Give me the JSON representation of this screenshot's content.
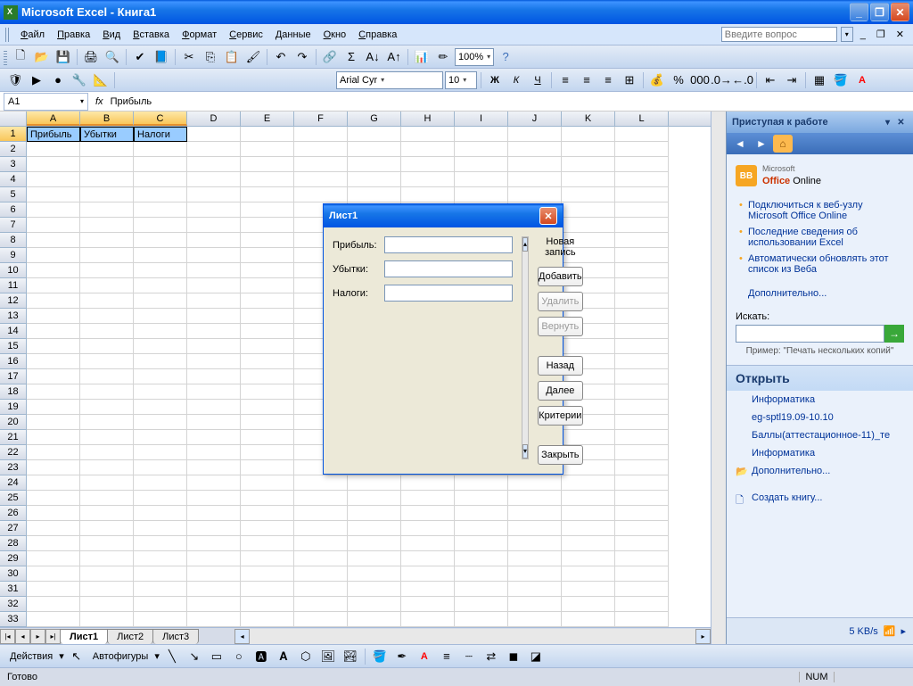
{
  "title": "Microsoft Excel - Книга1",
  "menu": [
    "Файл",
    "Правка",
    "Вид",
    "Вставка",
    "Формат",
    "Сервис",
    "Данные",
    "Окно",
    "Справка"
  ],
  "help_placeholder": "Введите вопрос",
  "zoom": "100%",
  "font": {
    "name": "Arial Cyr",
    "size": "10"
  },
  "namebox": "A1",
  "formula": "Прибыль",
  "columns": [
    "A",
    "B",
    "C",
    "D",
    "E",
    "F",
    "G",
    "H",
    "I",
    "J",
    "K",
    "L"
  ],
  "selected_cols": [
    "A",
    "B",
    "C"
  ],
  "headers": [
    "Прибыль",
    "Убытки",
    "Налоги"
  ],
  "row_count": 33,
  "sheet_tabs": [
    "Лист1",
    "Лист2",
    "Лист3"
  ],
  "active_tab": "Лист1",
  "dialog": {
    "title": "Лист1",
    "fields": [
      {
        "label": "Прибыль:"
      },
      {
        "label": "Убытки:"
      },
      {
        "label": "Налоги:"
      }
    ],
    "status": "Новая запись",
    "buttons": {
      "add": "Добавить",
      "delete": "Удалить",
      "revert": "Вернуть",
      "prev": "Назад",
      "next": "Далее",
      "criteria": "Критерии",
      "close": "Закрыть"
    }
  },
  "taskpane": {
    "title": "Приступая к работе",
    "brand_ms": "Microsoft",
    "brand": "Office Online",
    "links": [
      "Подключиться к веб-узлу Microsoft Office Online",
      "Последние сведения об использовании Excel",
      "Автоматически обновлять этот список из Веба"
    ],
    "more": "Дополнительно...",
    "search_label": "Искать:",
    "example": "Пример: \"Печать нескольких копий\"",
    "open_header": "Открыть",
    "recent": [
      "Информатика",
      "eg-sptl19.09-10.10",
      "Баллы(аттестационное-11)_те",
      "Информатика"
    ],
    "more_open": "Дополнительно...",
    "create": "Создать книгу...",
    "netspeed": "5 KB/s"
  },
  "drawbar": {
    "actions": "Действия",
    "autoshapes": "Автофигуры"
  },
  "status": {
    "ready": "Готово",
    "num": "NUM"
  }
}
